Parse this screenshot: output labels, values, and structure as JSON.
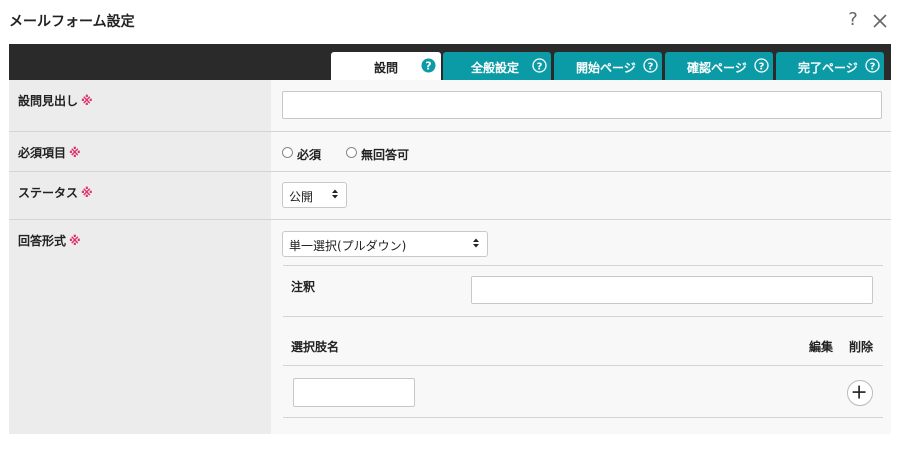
{
  "window": {
    "title": "メールフォーム設定",
    "help_icon": "question-mark-icon",
    "close_icon": "close-x-icon"
  },
  "tabs": [
    {
      "label": "設問",
      "active": true
    },
    {
      "label": "全般設定",
      "active": false
    },
    {
      "label": "開始ページ",
      "active": false
    },
    {
      "label": "確認ページ",
      "active": false
    },
    {
      "label": "完了ページ",
      "active": false
    }
  ],
  "colors": {
    "tab_accent": "#0b9ba6",
    "tabbar_bg": "#2a2a2a",
    "required_mark": "#e0336b",
    "label_bg": "#ececec"
  },
  "required_mark": "※",
  "fields": {
    "question_heading": {
      "label": "設問見出し",
      "value": ""
    },
    "required": {
      "label": "必須項目",
      "options": [
        "必須",
        "無回答可"
      ]
    },
    "status": {
      "label": "ステータス",
      "selected": "公開"
    },
    "answer_type": {
      "label": "回答形式",
      "selected": "単一選択(プルダウン)",
      "annotation_label": "注釈",
      "annotation_value": "",
      "choices_header": {
        "name": "選択肢名",
        "edit": "編集",
        "delete": "削除"
      },
      "new_choice_value": ""
    }
  }
}
